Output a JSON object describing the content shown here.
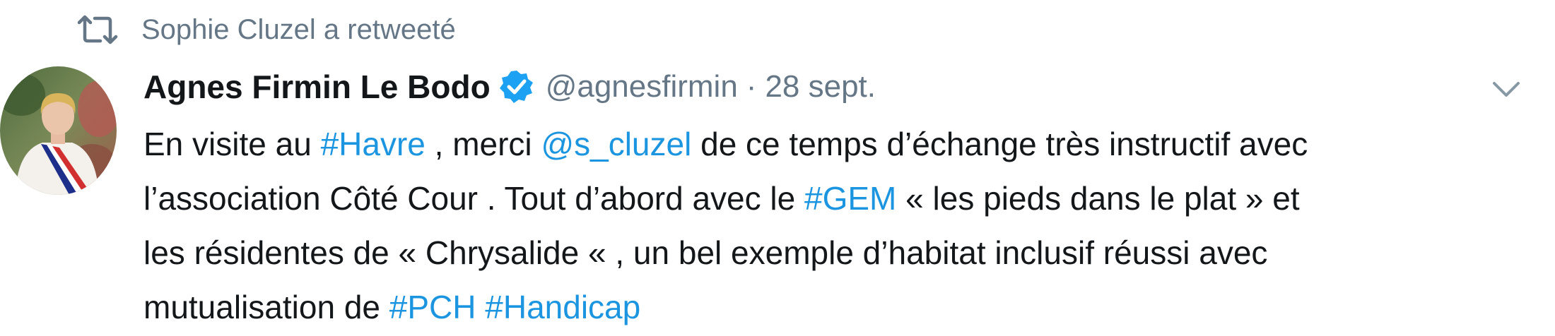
{
  "retweet": {
    "icon": "retweet-icon",
    "label": "Sophie Cluzel a retweeté"
  },
  "tweet": {
    "author_name": "Agnes Firmin Le Bodo",
    "verified_icon": "verified-badge-icon",
    "handle": "@agnesfirmin",
    "separator": "·",
    "date": "28 sept.",
    "menu_icon": "chevron-down-icon",
    "text_lines": [
      [
        {
          "t": "En visite au ",
          "link": false
        },
        {
          "t": "#Havre",
          "link": true
        },
        {
          "t": " , merci ",
          "link": false
        },
        {
          "t": "@s_cluzel",
          "link": true
        },
        {
          "t": " de ce temps d’échange très instructif avec",
          "link": false
        }
      ],
      [
        {
          "t": "l’association Côté Cour . Tout d’abord avec le ",
          "link": false
        },
        {
          "t": "#GEM",
          "link": true
        },
        {
          "t": " « les pieds dans le plat » et",
          "link": false
        }
      ],
      [
        {
          "t": "les résidentes de « Chrysalide « , un bel exemple d’habitat inclusif réussi avec",
          "link": false
        }
      ],
      [
        {
          "t": "mutualisation de ",
          "link": false
        },
        {
          "t": "#PCH",
          "link": true
        },
        {
          "t": " ",
          "link": false
        },
        {
          "t": "#Handicap",
          "link": true
        }
      ]
    ]
  },
  "colors": {
    "link": "#1b95e0",
    "muted": "#657786",
    "text": "#14171a",
    "verified": "#1da1f2"
  }
}
